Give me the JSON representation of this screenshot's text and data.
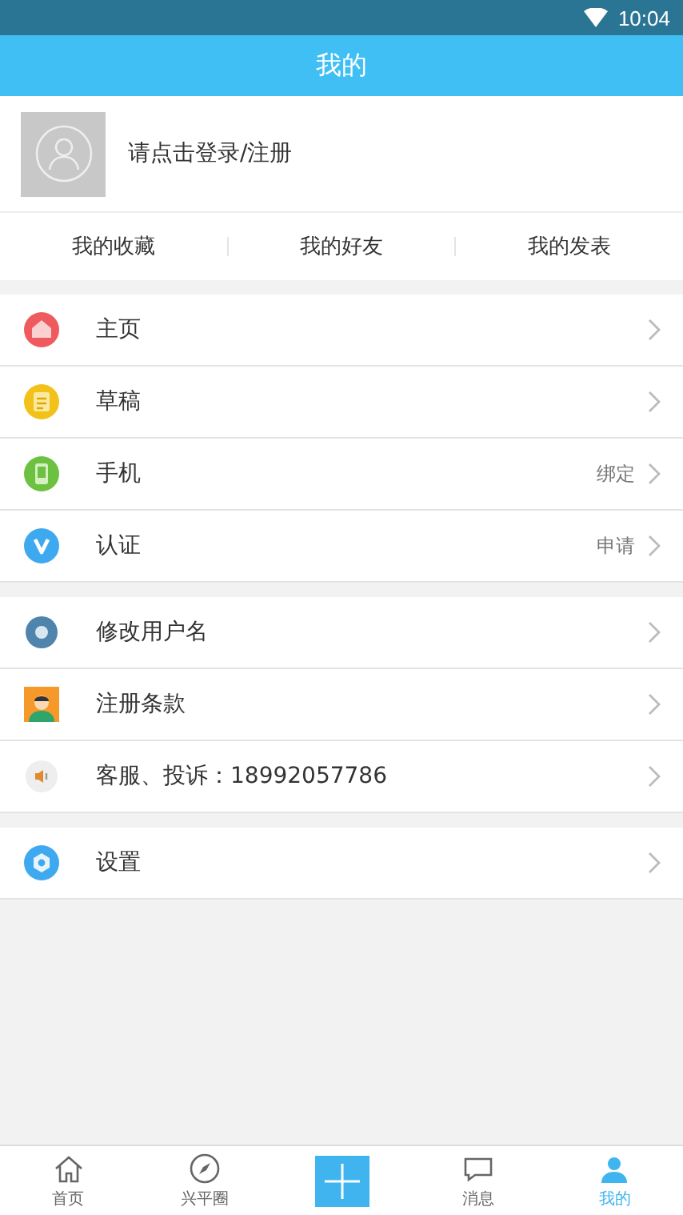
{
  "status_bar": {
    "time": "10:04"
  },
  "header": {
    "title": "我的"
  },
  "profile": {
    "login_text": "请点击登录/注册"
  },
  "quick_links": [
    "我的收藏",
    "我的好友",
    "我的发表"
  ],
  "menu_groups": [
    {
      "items": [
        {
          "kind": "home",
          "label": "主页"
        },
        {
          "kind": "draft",
          "label": "草稿"
        },
        {
          "kind": "phone",
          "label": "手机",
          "value": "绑定"
        },
        {
          "kind": "verify",
          "label": "认证",
          "value": "申请"
        }
      ]
    },
    {
      "items": [
        {
          "kind": "rename",
          "label": "修改用户名"
        },
        {
          "kind": "terms",
          "label": "注册条款"
        },
        {
          "kind": "service",
          "label": "客服、投诉：18992057786"
        }
      ]
    },
    {
      "items": [
        {
          "kind": "settings",
          "label": "设置"
        }
      ]
    }
  ],
  "bottom_nav": [
    {
      "kind": "home",
      "label": "首页",
      "selected": false
    },
    {
      "kind": "compass",
      "label": "兴平圈",
      "selected": false
    },
    {
      "kind": "plus",
      "selected": false
    },
    {
      "kind": "message",
      "label": "消息",
      "selected": false
    },
    {
      "kind": "person",
      "label": "我的",
      "selected": true
    }
  ]
}
